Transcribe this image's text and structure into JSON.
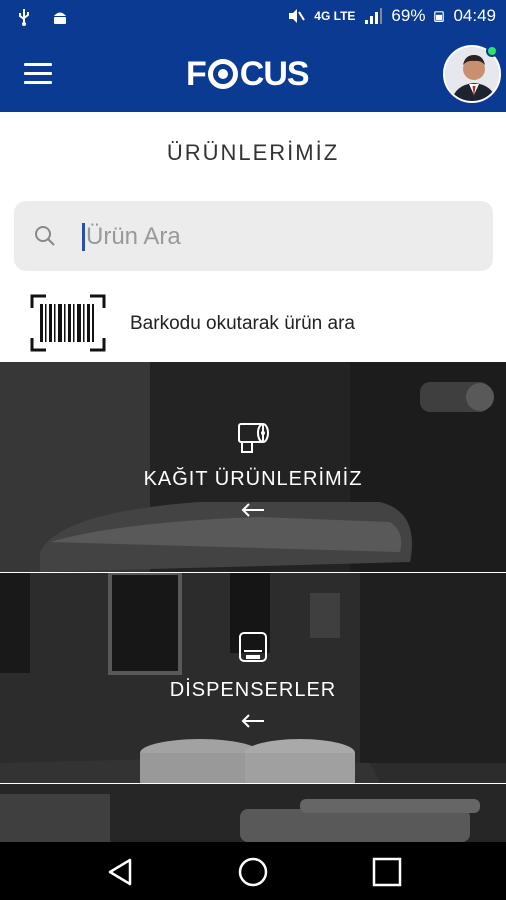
{
  "status_bar": {
    "battery_percent": "69%",
    "time": "04:49",
    "network": "4G LTE",
    "icons": [
      "usb-icon",
      "android-icon",
      "mute-icon",
      "lte-icon",
      "signal-icon",
      "battery-icon"
    ]
  },
  "app_bar": {
    "logo_text": "FOCUS",
    "menu_icon": "hamburger-menu-icon",
    "avatar_online_color": "#2ee36c"
  },
  "page": {
    "title": "ÜRÜNLERİMİZ"
  },
  "search": {
    "placeholder": "Ürün Ara",
    "value": ""
  },
  "barcode": {
    "label": "Barkodu okutarak ürün ara"
  },
  "categories": [
    {
      "label": "KAĞIT ÜRÜNLERİMİZ",
      "icon": "toilet-paper-icon"
    },
    {
      "label": "DİSPENSERLER",
      "icon": "dispenser-icon"
    },
    {
      "label": "",
      "icon": ""
    }
  ],
  "nav_bar": {
    "buttons": [
      "back-triangle-icon",
      "home-circle-icon",
      "recents-square-icon"
    ]
  },
  "colors": {
    "brand_blue": "#0b3a93",
    "status_online": "#2ee36c"
  }
}
